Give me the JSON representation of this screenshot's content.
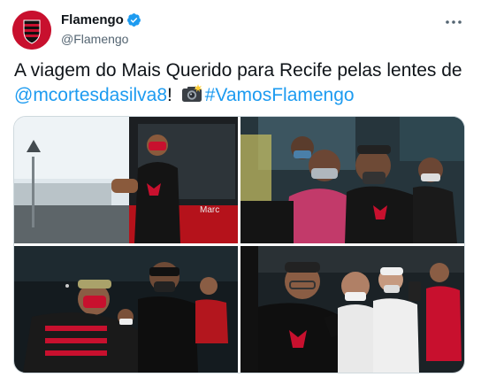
{
  "author": {
    "name": "Flamengo",
    "handle": "@Flamengo",
    "verified": true,
    "avatar_icon": "flamengo-crest-icon"
  },
  "tweet": {
    "text_part1": "A viagem do Mais Querido para Recife pelas lentes de ",
    "mention": "@mcortesdasilva8",
    "text_part2": "! ",
    "camera_icon": "camera-flash-emoji",
    "hashtag": "#VamosFlamengo"
  },
  "menu": {
    "icon": "more-horizontal-icon"
  },
  "colors": {
    "brand_red": "#c8102e",
    "link_blue": "#1d9bf0",
    "text": "#0f1419",
    "muted": "#536471"
  },
  "photos": [
    {
      "name": "photo-player-boarding-bus"
    },
    {
      "name": "photo-selfie-with-fan"
    },
    {
      "name": "photo-fans-with-masks"
    },
    {
      "name": "photo-fans-taking-photos"
    }
  ]
}
